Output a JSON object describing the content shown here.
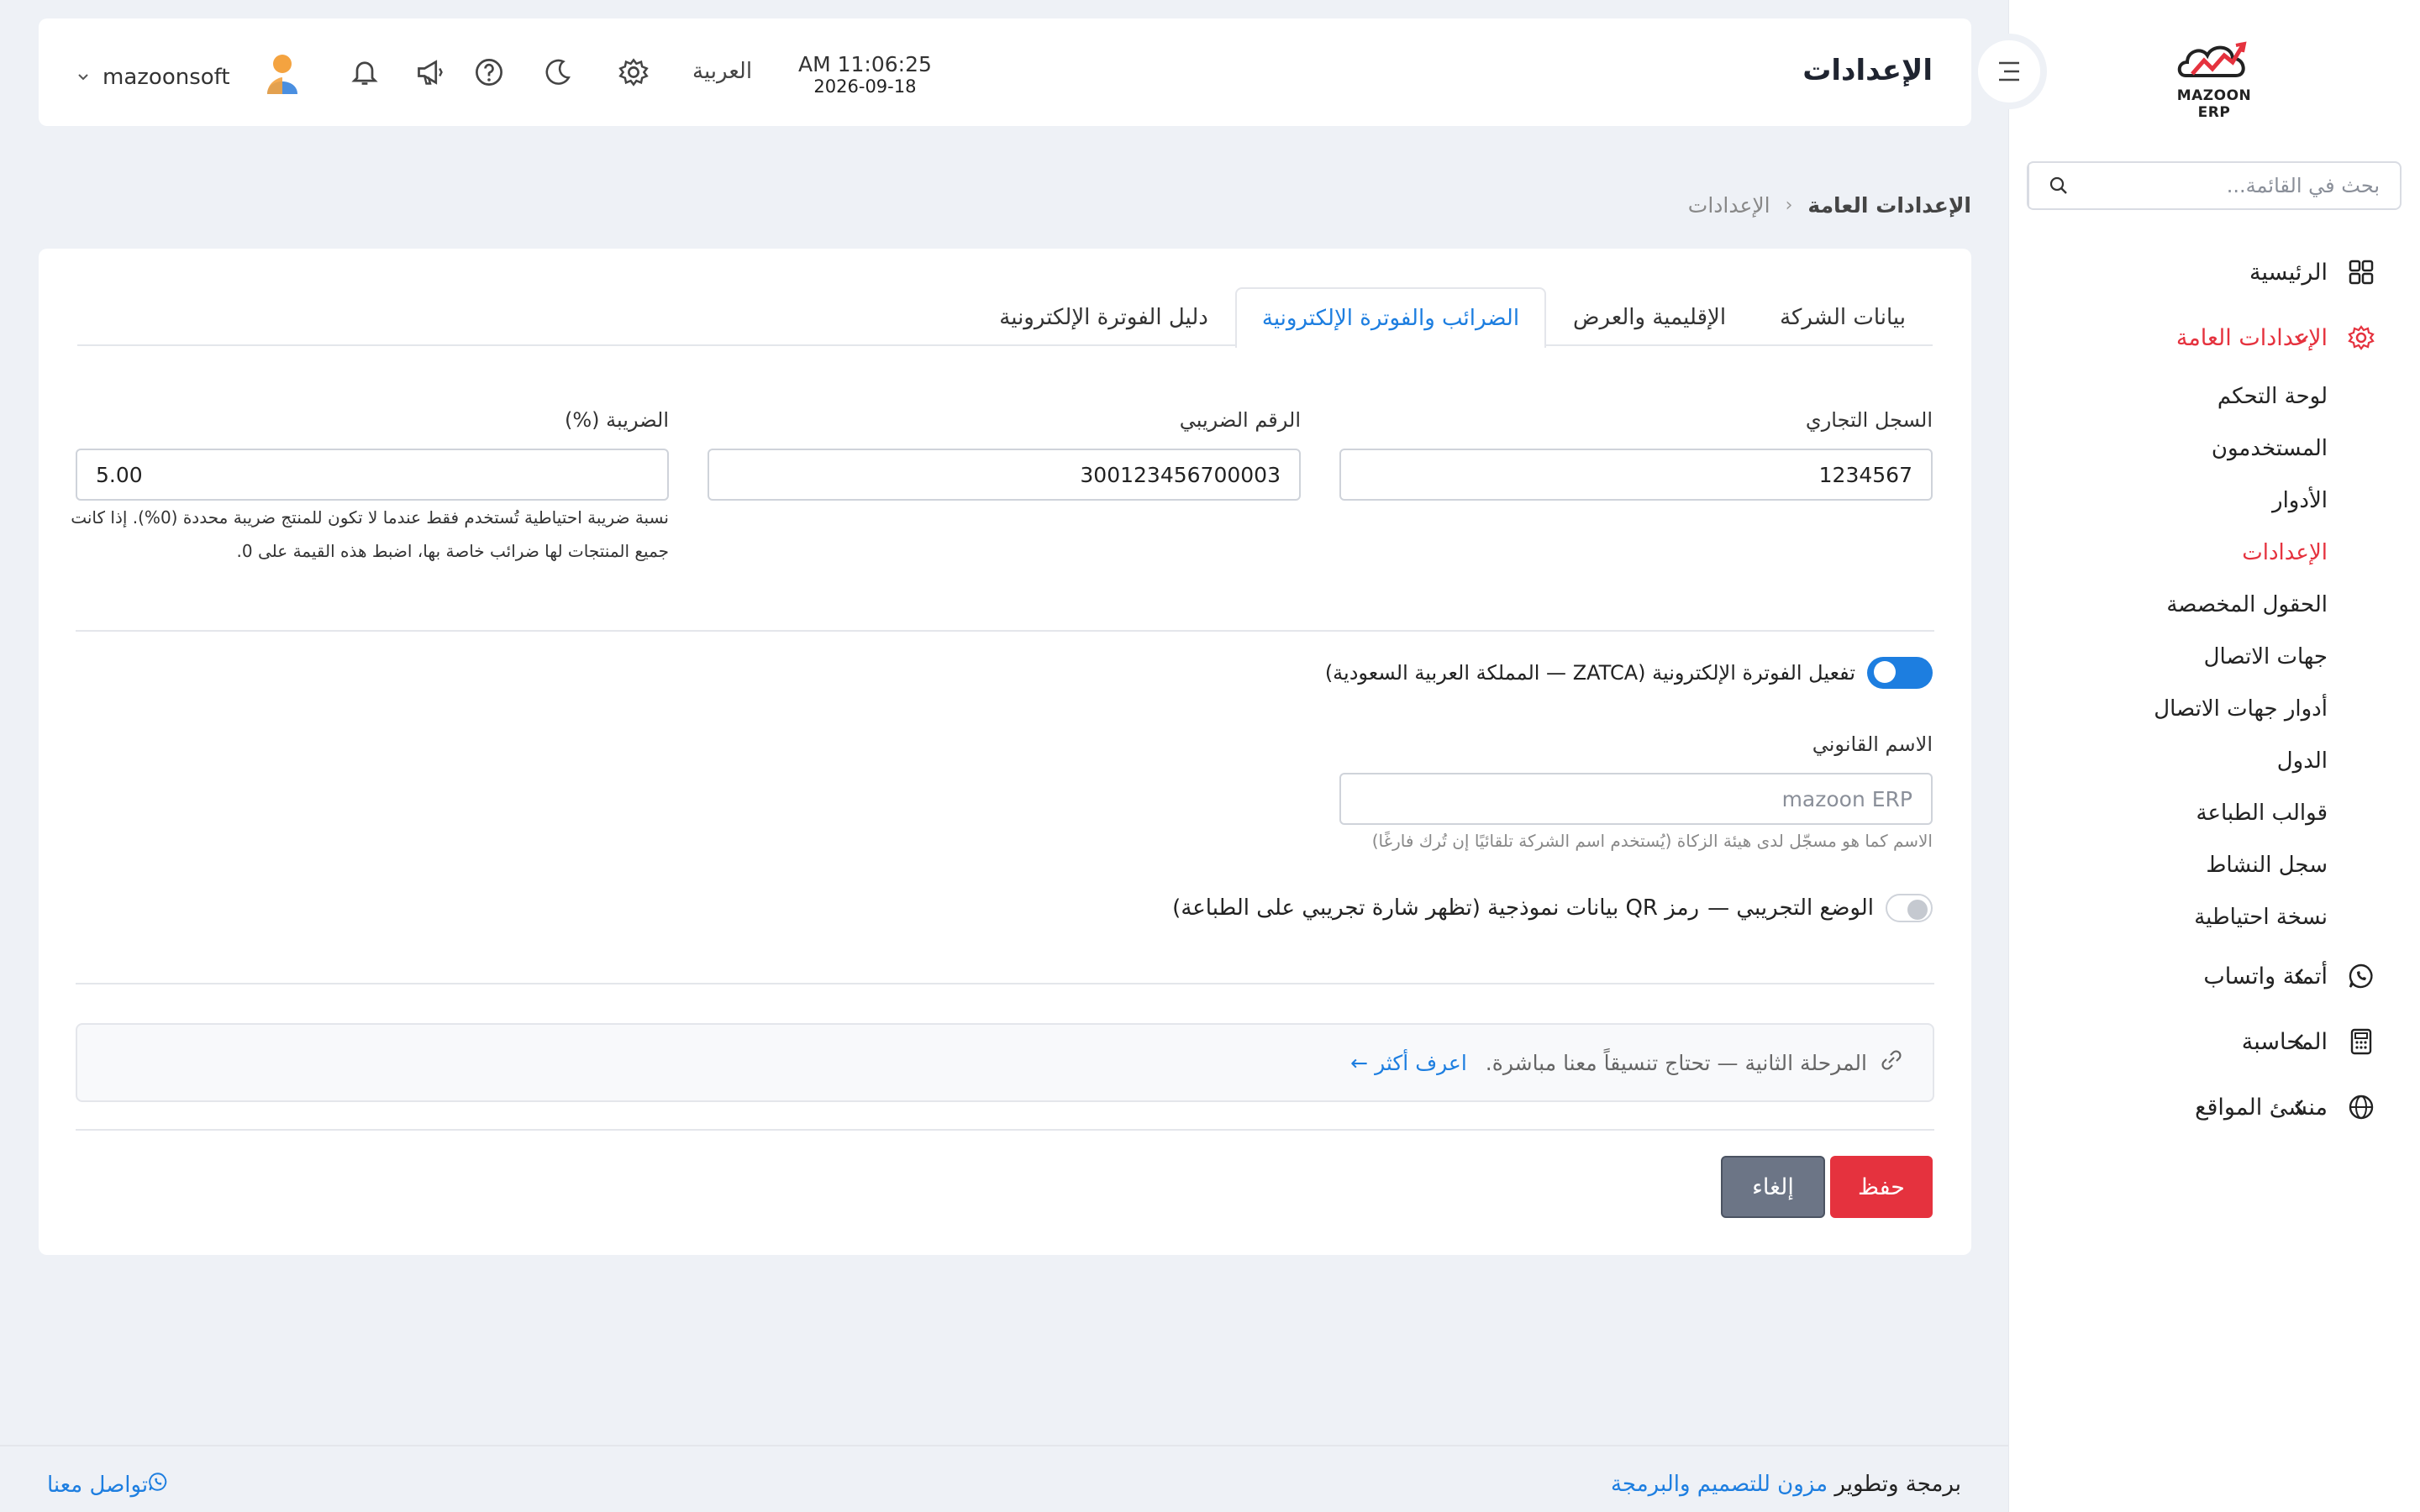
{
  "header": {
    "page_title": "الإعدادات",
    "time": "AM 11:06:25",
    "date": "2026-09-18",
    "language": "العربية",
    "username": "mazoonsoft"
  },
  "brand": {
    "logo_text": "MAZOON ERP"
  },
  "sidebar": {
    "search_placeholder": "بحث في القائمة...",
    "items": [
      {
        "label": "الرئيسية",
        "icon": "grid-icon"
      },
      {
        "label": "الإعدادات العامة",
        "icon": "gear-icon",
        "expanded": true
      },
      {
        "label": "أتمتة واتساب",
        "icon": "whatsapp-icon"
      },
      {
        "label": "المحاسبة",
        "icon": "calculator-icon"
      },
      {
        "label": "منشئ المواقع",
        "icon": "globe-icon"
      }
    ],
    "subitems": [
      "لوحة التحكم",
      "المستخدمون",
      "الأدوار",
      "الإعدادات",
      "الحقول المخصصة",
      "جهات الاتصال",
      "أدوار جهات الاتصال",
      "الدول",
      "قوالب الطباعة",
      "سجل النشاط",
      "نسخة احتياطية"
    ]
  },
  "breadcrumb": {
    "parent": "الإعدادات العامة",
    "separator": "‹",
    "current": "الإعدادات"
  },
  "tabs": [
    "بيانات الشركة",
    "الإقليمية والعرض",
    "الضرائب والفوترة الإلكترونية",
    "دليل الفوترة الإلكترونية"
  ],
  "form": {
    "commercial_register_label": "السجل التجاري",
    "commercial_register_value": "1234567",
    "tax_number_label": "الرقم الضريبي",
    "tax_number_value": "300123456700003",
    "tax_rate_label": "الضريبة (%)",
    "tax_rate_value": "5.00",
    "tax_rate_help_1": "نسبة ضريبة احتياطية تُستخدم فقط عندما لا تكون للمنتج ضريبة محددة (0%). إذا كانت",
    "tax_rate_help_2": "جميع المنتجات لها ضرائب خاصة بها، اضبط هذه القيمة على 0.",
    "zatca_toggle_label": "تفعيل الفوترة الإلكترونية (ZATCA — المملكة العربية السعودية)",
    "zatca_enabled": true,
    "legal_name_label": "الاسم القانوني",
    "legal_name_placeholder": "mazoon ERP",
    "legal_name_help": "الاسم كما هو مسجّل لدى هيئة الزكاة (يُستخدم اسم الشركة تلقائيًا إن تُرك فارغًا)",
    "sandbox_toggle_label_a": "الوضع التجريبي —",
    "sandbox_toggle_label_b": "رمز QR بيانات نموذجية (تظهر شارة تجريبي على الطباعة)",
    "sandbox_enabled": false
  },
  "info": {
    "text": "المرحلة الثانية — تحتاج تنسيقاً معنا مباشرة.",
    "link": "اعرف أكثر ←"
  },
  "actions": {
    "save": "حفظ",
    "cancel": "إلغاء"
  },
  "footer": {
    "credit_prefix": "برمجة وتطوير",
    "credit_brand": "مزون للتصميم والبرمجة",
    "contact": "تواصل معنا"
  },
  "colors": {
    "accent": "#1d7ee0",
    "danger": "#e5323e",
    "muted": "#6c7586"
  }
}
